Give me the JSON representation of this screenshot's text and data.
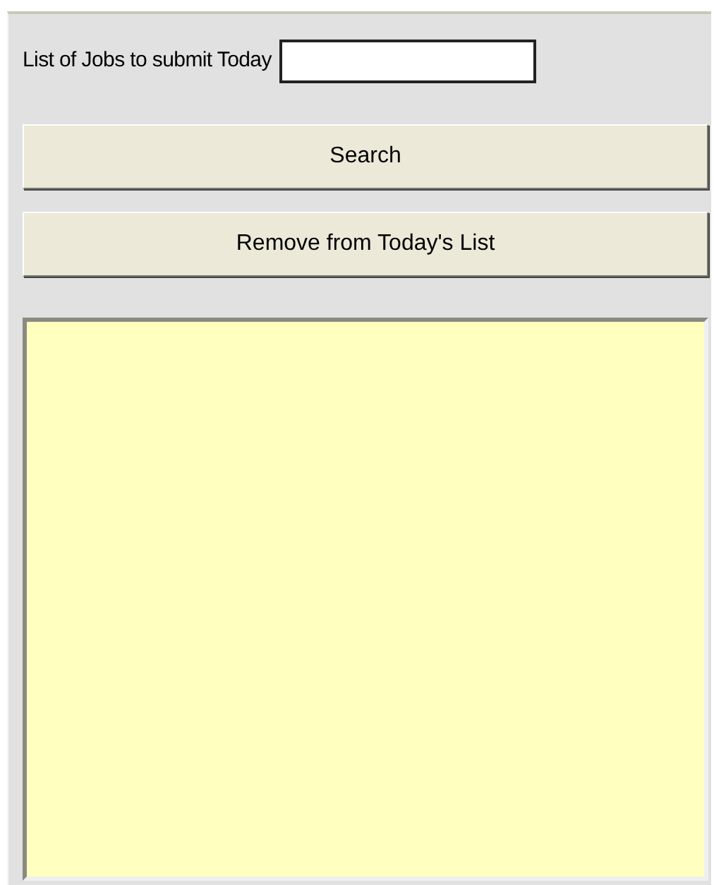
{
  "form": {
    "label": "List of Jobs to submit Today"
  },
  "buttons": [
    {
      "label": "Search"
    },
    {
      "label": "Remove from Today's List"
    }
  ]
}
